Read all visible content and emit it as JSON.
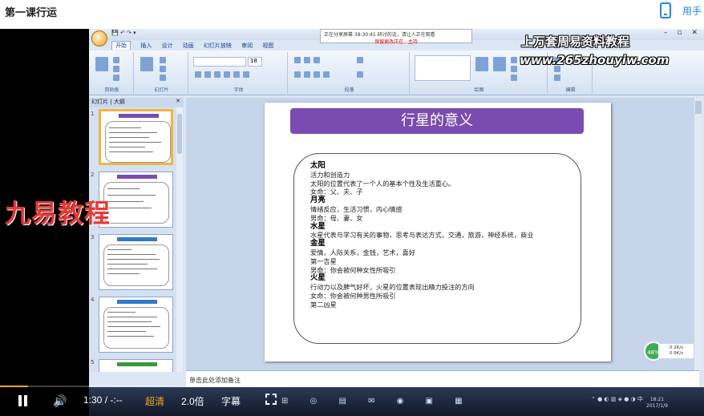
{
  "page": {
    "title": "第一课行运",
    "phone_link": "用手"
  },
  "ppt": {
    "qat": "💾 ↶ ↷ ▾",
    "sharing_status": "正在分享屏幕  38:30:41   研讨的话，请让人正在观看",
    "sharing_sub": "保留更改正在 · 主持",
    "window_controls": [
      "–",
      "▫",
      "✕"
    ],
    "tabs": [
      "开始",
      "插入",
      "设计",
      "动画",
      "幻灯片放映",
      "审阅",
      "视图"
    ],
    "groups": [
      "剪贴板",
      "幻灯片",
      "字体",
      "段落",
      "绘图",
      "编辑"
    ],
    "font_size": "18",
    "panel_tabs": [
      "幻灯片",
      "大纲"
    ],
    "panel_close": "✕",
    "thumbs": [
      {
        "num": "1",
        "bar_color": "#7a4bb0"
      },
      {
        "num": "2",
        "bar_color": "#7a4bb0"
      },
      {
        "num": "3",
        "bar_color": "#2f7bc9"
      },
      {
        "num": "4",
        "bar_color": "#2f7bc9"
      },
      {
        "num": "5",
        "bar_color": "#3b9a3b"
      }
    ],
    "slide": {
      "title": "行星的意义",
      "title_color": "#7a4bb0",
      "lines": [
        {
          "text": "太阳",
          "heading": true
        },
        {
          "text": "活力和创造力",
          "heading": false
        },
        {
          "text": "太阳的位置代表了一个人的基本个性及生活重心。",
          "heading": false
        },
        {
          "text": "女命：父、夫、子",
          "heading": false
        },
        {
          "text": "月亮",
          "heading": true
        },
        {
          "text": "情绪反应，生活习惯，内心情感",
          "heading": false
        },
        {
          "text": "男命：母、妻、女",
          "heading": false
        },
        {
          "text": "水星",
          "heading": true
        },
        {
          "text": "水星代表与学习有关的事物，思考与表达方式，交通，旅游，神经系统，商业",
          "heading": false
        },
        {
          "text": "金星",
          "heading": true
        },
        {
          "text": "爱情，人际关系，金钱，艺术，喜好",
          "heading": false
        },
        {
          "text": "第一吉星",
          "heading": false
        },
        {
          "text": "男命：你会被何种女性所吸引",
          "heading": false
        },
        {
          "text": "火星",
          "heading": true
        },
        {
          "text": "行动力以及脾气好坏，火星的位置表现出精力投注的方向",
          "heading": false
        },
        {
          "text": "女命：你会被何种男性所吸引",
          "heading": false
        },
        {
          "text": "第二凶星",
          "heading": false
        }
      ]
    },
    "notes_placeholder": "单击此处添加备注",
    "badge": "48%",
    "speed_up": "0.2K/s",
    "speed_down": "0.9K/s"
  },
  "watermarks": {
    "site_name": "上万套周易资料教程",
    "site_url": "www.265zhouyiw.com",
    "brand": "九易教程"
  },
  "player": {
    "time": "1:30 / -:--",
    "quality": "超清",
    "speed": "2.0倍",
    "subtitles": "字幕",
    "progress_fraction": 0.04
  },
  "taskbar": {
    "icons": "⊞ ◎ ▤ ✉ ◉ ▣ ▦",
    "tray": "⌃ ● ◐ ▥ ◈ ● ◑ 中",
    "time": "18:21",
    "date": "2017/1/9"
  }
}
